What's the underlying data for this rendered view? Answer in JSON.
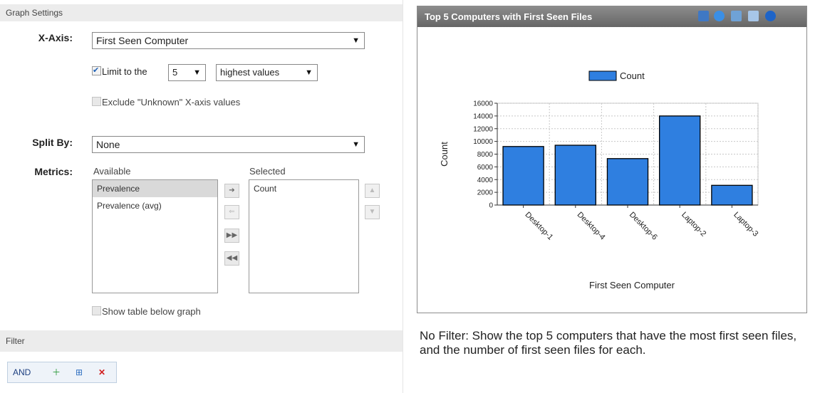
{
  "left": {
    "graph_settings_header": "Graph Settings",
    "xaxis": {
      "label": "X-Axis:",
      "value": "First Seen Computer"
    },
    "limit": {
      "label": "Limit to the",
      "count": "5",
      "mode": "highest values",
      "checked": true
    },
    "exclude": {
      "label": "Exclude \"Unknown\" X-axis values",
      "checked": false
    },
    "split": {
      "label": "Split By:",
      "value": "None"
    },
    "metrics": {
      "label": "Metrics:",
      "available_header": "Available",
      "selected_header": "Selected",
      "available": [
        "Prevalence",
        "Prevalence (avg)"
      ],
      "selected": [
        "Count"
      ]
    },
    "show_table": {
      "label": "Show table below graph",
      "checked": false
    },
    "filter_header": "Filter",
    "filter": {
      "and_label": "AND"
    }
  },
  "chart_panel": {
    "title": "Top 5 Computers with First Seen Files",
    "toolbar_icons": [
      "table-icon",
      "refresh-icon",
      "export-icon",
      "report-icon",
      "info-icon"
    ]
  },
  "caption": "No Filter: Show the top 5 computers that have the most  first seen files, and the number of first seen files for  each.",
  "chart_data": {
    "type": "bar",
    "title": "Top 5 Computers with First Seen Files",
    "categories": [
      "Desktop-1",
      "Desktop-4",
      "Desktop-6",
      "Laptop-2",
      "Laptop-3"
    ],
    "series": [
      {
        "name": "Count",
        "values": [
          9200,
          9400,
          7300,
          14000,
          3100
        ],
        "color": "#2f7fe0"
      }
    ],
    "xlabel": "First Seen Computer",
    "ylabel": "Count",
    "ylim": [
      0,
      16000
    ],
    "yticks": [
      0,
      2000,
      4000,
      6000,
      8000,
      10000,
      12000,
      14000,
      16000
    ],
    "grid": true,
    "legend": "top-center"
  }
}
